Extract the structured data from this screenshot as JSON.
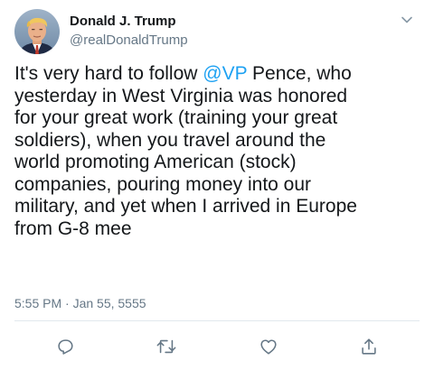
{
  "tweet": {
    "author": {
      "display_name": "Donald J. Trump",
      "handle": "@realDonaldTrump",
      "avatar_icon": "profile-photo"
    },
    "text_lines": [
      {
        "before": "It's very hard to follow ",
        "mention": "@VP",
        "after": " Pence, who"
      },
      {
        "text": "yesterday in West Virginia was honored"
      },
      {
        "text": "for your great work (training your great"
      },
      {
        "text": "soldiers), when you travel around the"
      },
      {
        "text": "world promoting American (stock)"
      },
      {
        "text": "companies, pouring money into our"
      },
      {
        "text": "military, and yet when I arrived in Europe"
      },
      {
        "text": "from G-8 mee"
      }
    ],
    "timestamp": "5:55 PM · Jan 55, 5555",
    "actions": {
      "reply_icon": "reply-icon",
      "retweet_icon": "retweet-icon",
      "like_icon": "heart-icon",
      "share_icon": "share-icon",
      "menu_icon": "chevron-down-icon"
    },
    "colors": {
      "accent": "#1da1f2",
      "text": "#14171a",
      "secondary": "#657786",
      "divider": "#e1e8ed"
    }
  }
}
